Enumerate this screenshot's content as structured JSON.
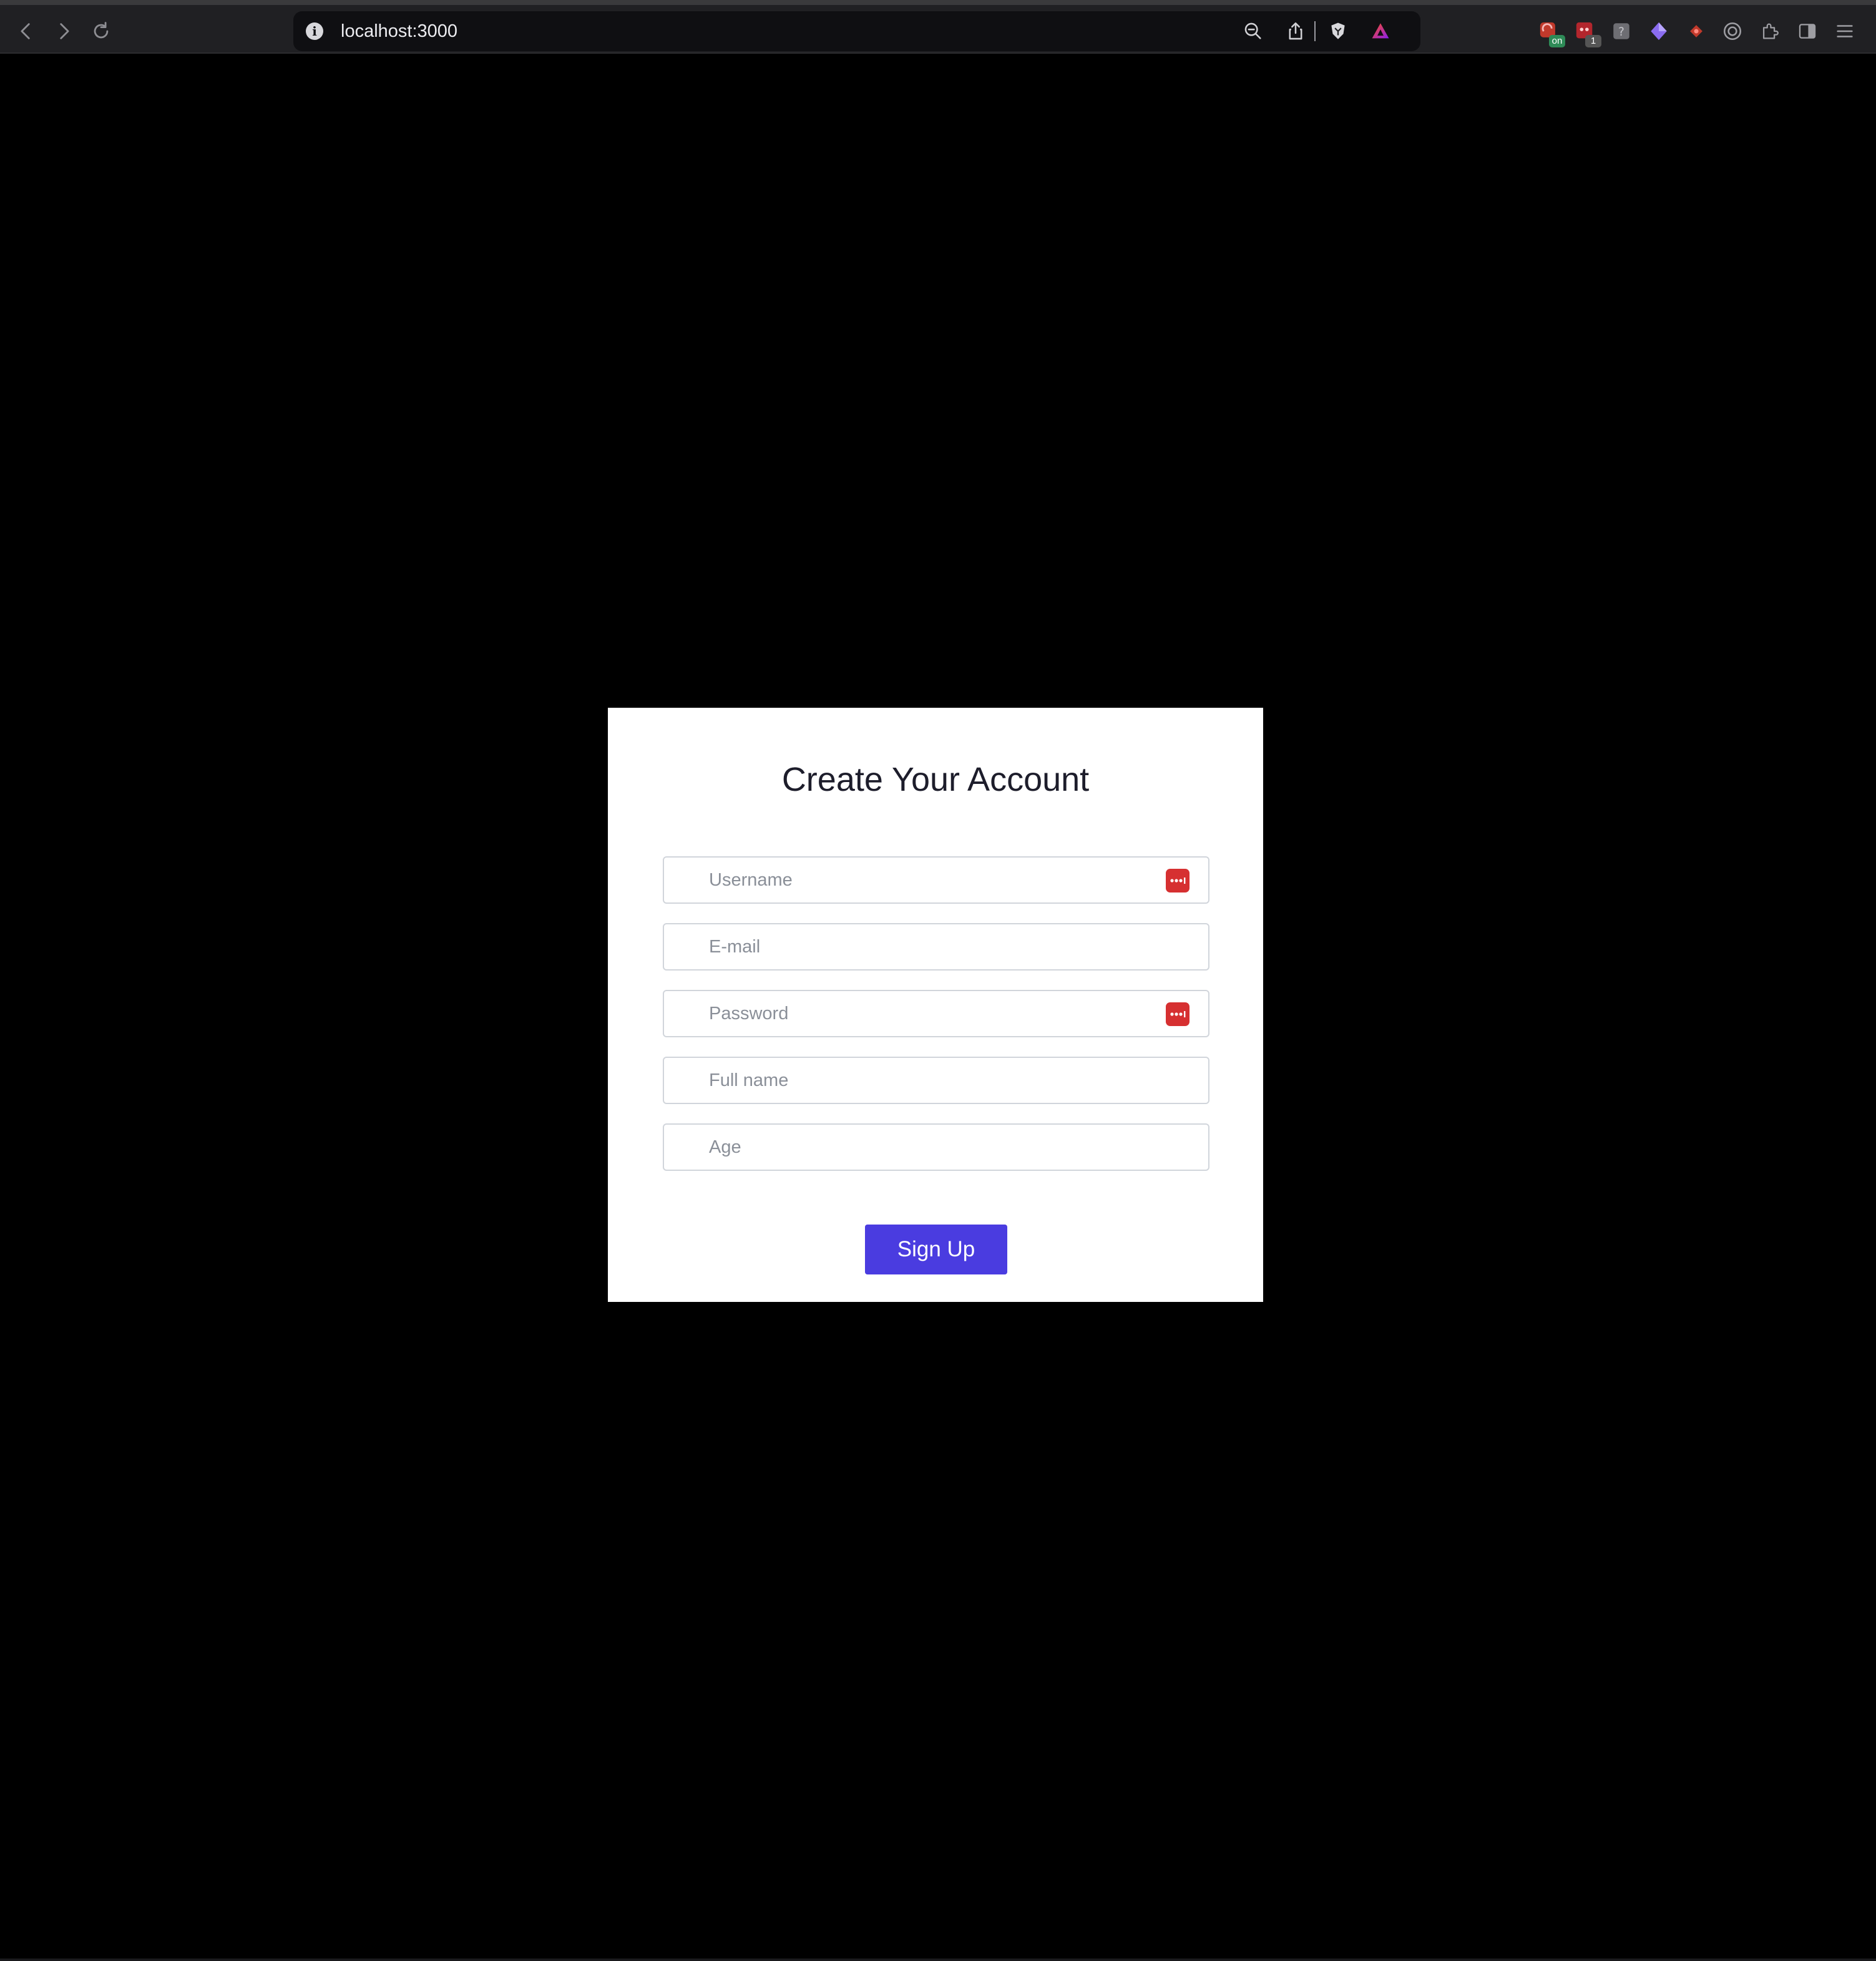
{
  "browser": {
    "url": "localhost:3000",
    "extensions": [
      {
        "name": "badge-extension-icon",
        "badge": "on",
        "badge_color": "#2e8b57"
      },
      {
        "name": "counter-extension-icon",
        "badge": "1",
        "badge_color": "#555555"
      },
      {
        "name": "unknown-extension-icon",
        "badge": ""
      },
      {
        "name": "diamond-extension-icon",
        "badge": ""
      },
      {
        "name": "red-extension-icon",
        "badge": ""
      },
      {
        "name": "target-extension-icon",
        "badge": ""
      },
      {
        "name": "extensions-puzzle-icon",
        "badge": ""
      },
      {
        "name": "sidebar-toggle-icon",
        "badge": ""
      },
      {
        "name": "menu-icon",
        "badge": ""
      }
    ]
  },
  "form": {
    "title": "Create Your Account",
    "fields": [
      {
        "name": "username",
        "placeholder": "Username",
        "value": ""
      },
      {
        "name": "email",
        "placeholder": "E-mail",
        "value": ""
      },
      {
        "name": "password",
        "placeholder": "Password",
        "value": ""
      },
      {
        "name": "full-name",
        "placeholder": "Full name",
        "value": ""
      },
      {
        "name": "age",
        "placeholder": "Age",
        "value": ""
      }
    ],
    "submit_label": "Sign Up"
  },
  "colors": {
    "page_background": "#000000",
    "card_background": "#ffffff",
    "button_background": "#4a3ce0",
    "password_manager_icon": "#d63031"
  }
}
